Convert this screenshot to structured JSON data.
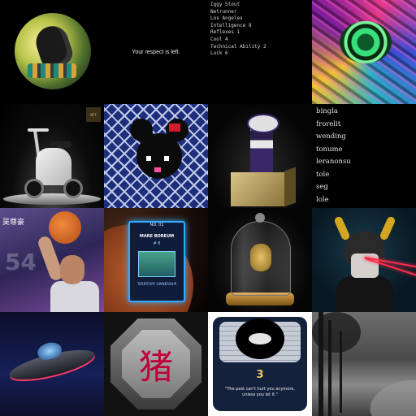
{
  "tiles": {
    "t1": {
      "text": "Your respect is left."
    },
    "t2": {
      "lines": [
        "Iggy Stout",
        "Netrunner",
        "Los Angeles",
        "Intelligence 8",
        "Reflexes 1",
        "Cool 4",
        "Technical Ability 2",
        "Luck 6"
      ]
    },
    "t4": {
      "badge": "NFT"
    },
    "t7": {
      "words": [
        "bingla",
        "frorelit",
        "wending",
        "tonume",
        "leranonsu",
        "tole",
        "seg",
        "lole"
      ]
    },
    "t8": {
      "name": "吴尊豪",
      "number": "54"
    },
    "t9": {
      "label": "NO. 01",
      "title": "MARE BOREUM",
      "number": "# 8",
      "footer": "TERRITORY OWNERSHIP"
    },
    "t13": {
      "glyph": "猪"
    },
    "t14": {
      "number": "3",
      "quote": "\"The past can't hurt you anymore, unless you let it.\""
    }
  }
}
